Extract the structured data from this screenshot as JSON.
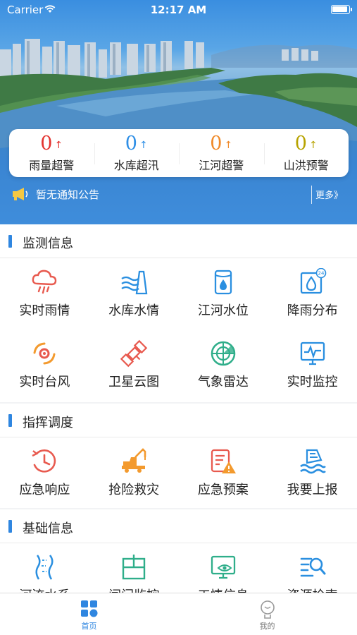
{
  "statusbar": {
    "carrier": "Carrier",
    "time": "12:17 AM"
  },
  "alerts": [
    {
      "value": "0",
      "label": "雨量超警",
      "color": "#e3332f",
      "arrow": "↑"
    },
    {
      "value": "0",
      "label": "水库超汛",
      "color": "#2f8fe6",
      "arrow": "↑"
    },
    {
      "value": "0",
      "label": "江河超警",
      "color": "#f08a2a",
      "arrow": "↑"
    },
    {
      "value": "0",
      "label": "山洪预警",
      "color": "#b7a300",
      "arrow": "↑"
    }
  ],
  "notice": {
    "text": "暂无通知公告",
    "more": "更多》"
  },
  "sections": [
    {
      "title": "监测信息",
      "items": [
        {
          "label": "实时雨情",
          "icon": "rain-cloud-icon"
        },
        {
          "label": "水库水情",
          "icon": "reservoir-dam-icon"
        },
        {
          "label": "江河水位",
          "icon": "water-level-icon"
        },
        {
          "label": "降雨分布",
          "icon": "rainfall-24h-icon"
        },
        {
          "label": "实时台风",
          "icon": "typhoon-icon"
        },
        {
          "label": "卫星云图",
          "icon": "satellite-icon"
        },
        {
          "label": "气象雷达",
          "icon": "radar-icon"
        },
        {
          "label": "实时监控",
          "icon": "monitor-icon"
        }
      ]
    },
    {
      "title": "指挥调度",
      "items": [
        {
          "label": "应急响应",
          "icon": "emergency-clock-icon"
        },
        {
          "label": "抢险救灾",
          "icon": "rescue-crane-icon"
        },
        {
          "label": "应急预案",
          "icon": "plan-warning-icon"
        },
        {
          "label": "我要上报",
          "icon": "flood-report-icon"
        }
      ]
    },
    {
      "title": "基础信息",
      "items": [
        {
          "label": "河流水系",
          "icon": "river-icon"
        },
        {
          "label": "闸门监控",
          "icon": "sluice-gate-icon"
        },
        {
          "label": "工情信息",
          "icon": "project-info-icon"
        },
        {
          "label": "资源检索",
          "icon": "resource-search-icon"
        }
      ]
    }
  ],
  "tabs": [
    {
      "label": "首页",
      "icon": "home-grid-icon",
      "active": true
    },
    {
      "label": "我的",
      "icon": "profile-icon",
      "active": false
    }
  ],
  "colors": {
    "accent": "#2f86e0",
    "red": "#e85a4f",
    "blue": "#2a8fe0",
    "orange": "#f39a2e",
    "green": "#2fae8a"
  }
}
